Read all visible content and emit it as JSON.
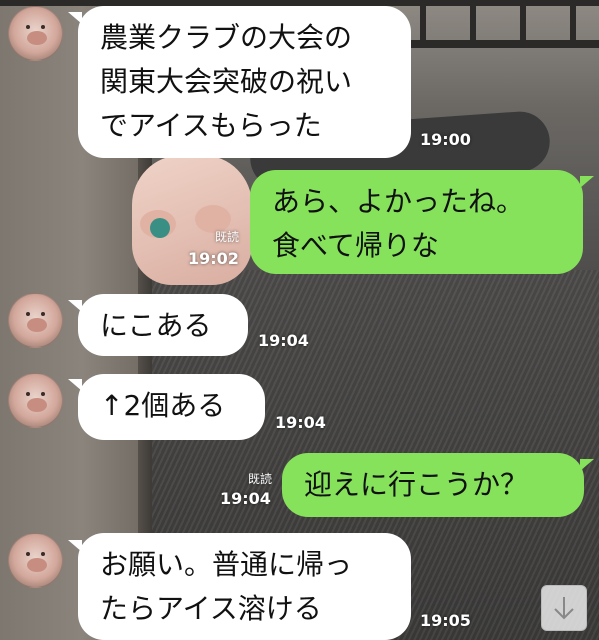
{
  "messages": [
    {
      "side": "in",
      "lines": [
        "農業クラブの大会の",
        "関東大会突破の祝い",
        "でアイスもらった"
      ],
      "time": "19:00"
    },
    {
      "side": "out",
      "lines": [
        "あら、よかったね。",
        "食べて帰りな"
      ],
      "time": "19:02",
      "read": "既読"
    },
    {
      "side": "in",
      "lines": [
        "にこある"
      ],
      "time": "19:04"
    },
    {
      "side": "in",
      "lines": [
        "↑2個ある"
      ],
      "time": "19:04"
    },
    {
      "side": "out",
      "lines": [
        "迎えに行こうか？"
      ],
      "time": "19:04",
      "read": "既読"
    },
    {
      "side": "in",
      "lines": [
        "お願い。普通に帰っ",
        "たらアイス溶ける"
      ],
      "time": "19:05"
    }
  ],
  "scroll_button": {
    "icon": "arrow-down-icon",
    "glyph": "↓"
  }
}
